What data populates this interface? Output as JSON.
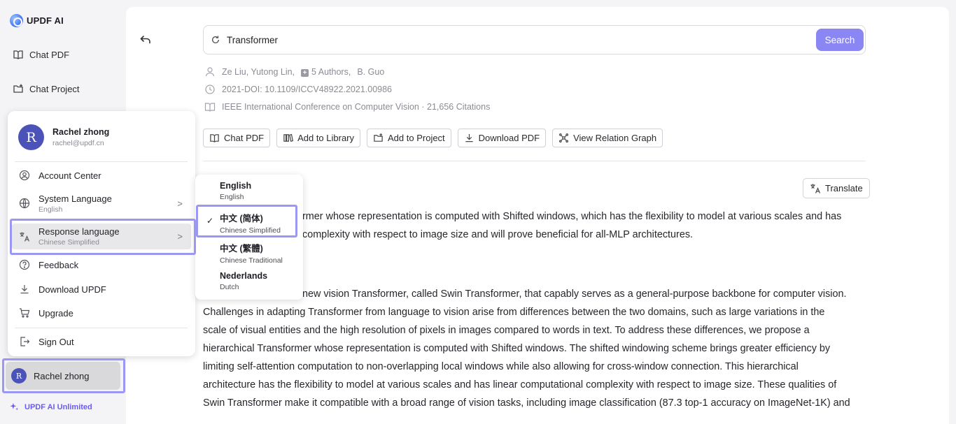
{
  "sidebar": {
    "brand": "UPDF AI",
    "nav": [
      {
        "label": "Chat PDF",
        "icon": "book-icon"
      },
      {
        "label": "Chat Project",
        "icon": "folder-plus-icon"
      }
    ],
    "user_initial": "R",
    "user_name": "Rachel zhong",
    "plan_label": "UPDF AI Unlimited"
  },
  "profile_menu": {
    "avatar_initial": "R",
    "name": "Rachel zhong",
    "email": "rachel@updf.cn",
    "items": [
      {
        "label": "Account Center",
        "icon": "user-circle-icon"
      },
      {
        "label": "System Language",
        "sub": "English",
        "icon": "globe-icon"
      },
      {
        "label": "Response language",
        "sub": "Chinese Simplified",
        "icon": "translate-icon"
      },
      {
        "label": "Feedback",
        "icon": "question-circle-icon"
      },
      {
        "label": "Download UPDF",
        "icon": "download-icon"
      },
      {
        "label": "Upgrade",
        "icon": "cart-icon"
      },
      {
        "label": "Sign Out",
        "icon": "sign-out-icon"
      }
    ],
    "chevron": ">"
  },
  "language_menu": {
    "options": [
      {
        "label": "English",
        "sub": "English",
        "selected": false
      },
      {
        "label": "中文 (简体)",
        "sub": "Chinese Simplified",
        "selected": true
      },
      {
        "label": "中文 (繁體)",
        "sub": "Chinese Traditional",
        "selected": false
      },
      {
        "label": "Nederlands",
        "sub": "Dutch",
        "selected": false
      }
    ],
    "check": "✓"
  },
  "search": {
    "query": "Transformer",
    "button": "Search"
  },
  "paper": {
    "authors": "Ze Liu,  Yutong Lin,",
    "more_authors": "5 Authors,",
    "last_author": "B. Guo",
    "plus": "+",
    "date_doi": "2021-DOI: 10.1109/ICCV48922.2021.00986",
    "venue": "IEEE International Conference on Computer Vision · 21,656 Citations"
  },
  "actions": [
    {
      "label": "Chat PDF",
      "icon": "book-icon"
    },
    {
      "label": "Add to Library",
      "icon": "library-icon"
    },
    {
      "label": "Add to Project",
      "icon": "folder-plus-icon"
    },
    {
      "label": "Download PDF",
      "icon": "download-icon"
    },
    {
      "label": "View Relation Graph",
      "icon": "graph-icon"
    }
  ],
  "translate_label": "Translate",
  "summary_lines": [
    "rmer whose representation is computed with Shifted windows, which has the flexibility to model at various scales and has",
    "complexity with respect to image size and will prove beneficial for all-MLP architectures."
  ],
  "abstract_lines": [
    "new vision Transformer, called Swin Transformer, that capably serves as a general-purpose backbone for computer vision.",
    "Challenges in adapting Transformer from language to vision arise from differences between the two domains, such as large variations in the",
    "scale of visual entities and the high resolution of pixels in images compared to words in text. To address these differences, we propose a",
    "hierarchical Transformer whose representation is computed with Shifted windows. The shifted windowing scheme brings greater efficiency by",
    "limiting self-attention computation to non-overlapping local windows while also allowing for cross-window connection. This hierarchical",
    "architecture has the flexibility to model at various scales and has linear computational complexity with respect to image size. These qualities of",
    "Swin Transformer make it compatible with a broad range of vision tasks, including image classification (87.3 top-1 accuracy on ImageNet-1K) and"
  ],
  "colors": {
    "accent": "#8a86f4",
    "highlight": "#9b98f3",
    "avatar": "#4b53b8"
  }
}
